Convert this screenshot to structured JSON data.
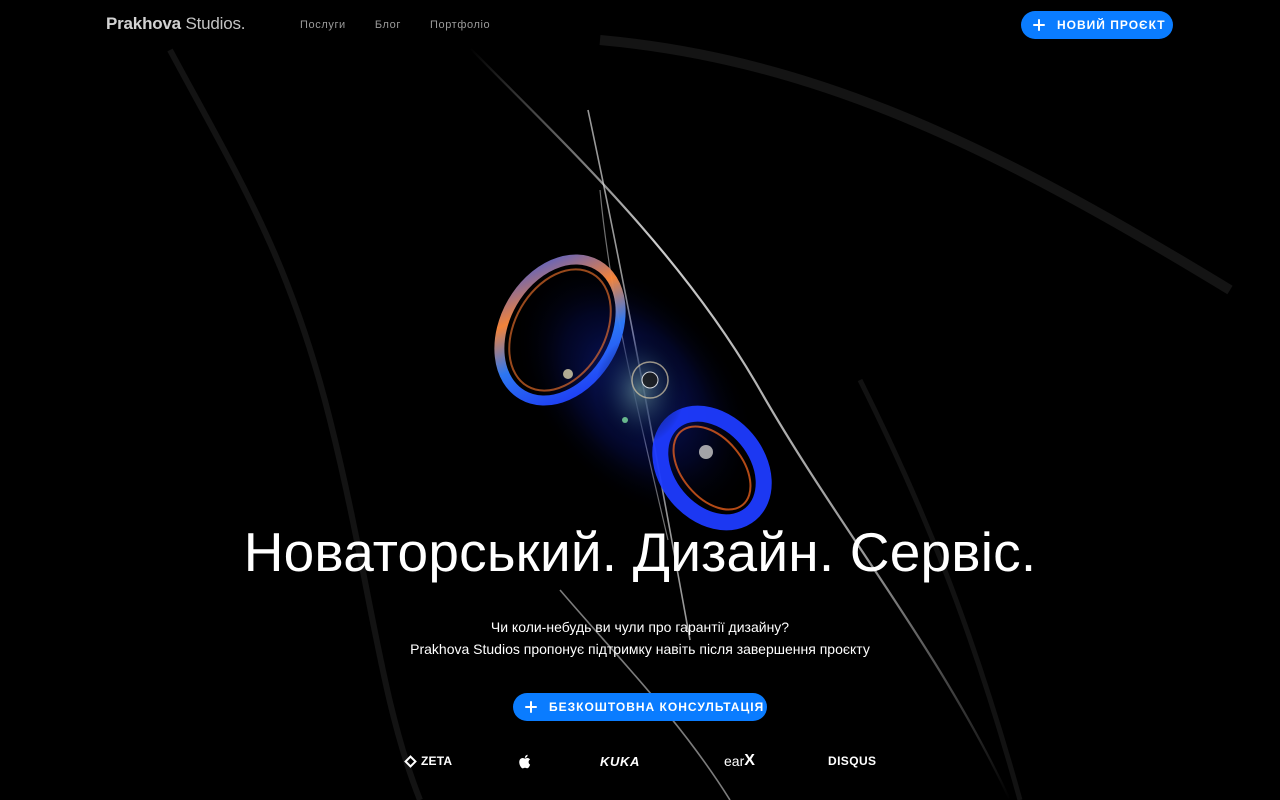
{
  "header": {
    "logo_bold": "Prakhova",
    "logo_light": " Studios.",
    "nav": [
      {
        "label": "Послуги"
      },
      {
        "label": "Блог"
      },
      {
        "label": "Портфоліо"
      }
    ],
    "new_project_label": "НОВИЙ ПРОЄКТ"
  },
  "hero": {
    "title": "Новаторський. Дизайн. Сервіс.",
    "subtitle_line1": "Чи коли-небудь ви чули про гарантії дизайну?",
    "subtitle_line2": "Prakhova Studios пропонує підтримку навіть після завершення проєкту",
    "cta_label": "БЕЗКОШТОВНА КОНСУЛЬТАЦІЯ"
  },
  "clients": {
    "zeta": "ZETA",
    "apple_icon": "apple-logo-icon",
    "kuka": "KUKA",
    "earx_prefix": "ear",
    "earx_suffix": "X",
    "disqus": "DISQUS"
  },
  "colors": {
    "accent": "#0a7cff",
    "background": "#000000",
    "nav_text": "#9a9a9a"
  }
}
